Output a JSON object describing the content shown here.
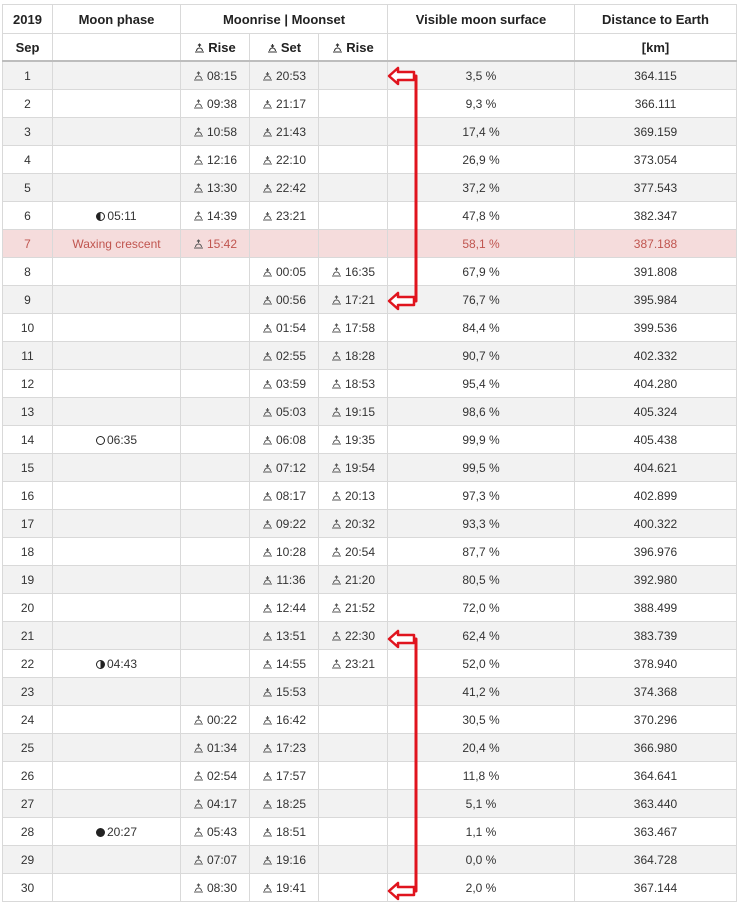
{
  "header": {
    "year": "2019",
    "moon_phase": "Moon phase",
    "moonrise_moonset": "Moonrise | Moonset",
    "visible_surface": "Visible moon surface",
    "distance": "Distance to Earth",
    "month": "Sep",
    "rise1": "Rise",
    "set": "Set",
    "rise2": "Rise",
    "unit": "[km]"
  },
  "rows": [
    {
      "day": "1",
      "phase": "",
      "phase_icon": "",
      "rise1": "08:15",
      "set": "20:53",
      "rise2": "",
      "surface": "3,5 %",
      "distance": "364.115"
    },
    {
      "day": "2",
      "phase": "",
      "phase_icon": "",
      "rise1": "09:38",
      "set": "21:17",
      "rise2": "",
      "surface": "9,3 %",
      "distance": "366.111"
    },
    {
      "day": "3",
      "phase": "",
      "phase_icon": "",
      "rise1": "10:58",
      "set": "21:43",
      "rise2": "",
      "surface": "17,4 %",
      "distance": "369.159"
    },
    {
      "day": "4",
      "phase": "",
      "phase_icon": "",
      "rise1": "12:16",
      "set": "22:10",
      "rise2": "",
      "surface": "26,9 %",
      "distance": "373.054"
    },
    {
      "day": "5",
      "phase": "",
      "phase_icon": "",
      "rise1": "13:30",
      "set": "22:42",
      "rise2": "",
      "surface": "37,2 %",
      "distance": "377.543"
    },
    {
      "day": "6",
      "phase": "05:11",
      "phase_icon": "first-quarter",
      "rise1": "14:39",
      "set": "23:21",
      "rise2": "",
      "surface": "47,8 %",
      "distance": "382.347"
    },
    {
      "day": "7",
      "phase": "Waxing crescent",
      "phase_icon": "",
      "rise1": "15:42",
      "set": "",
      "rise2": "",
      "surface": "58,1 %",
      "distance": "387.188",
      "today": true
    },
    {
      "day": "8",
      "phase": "",
      "phase_icon": "",
      "rise1": "",
      "set": "00:05",
      "rise2": "16:35",
      "surface": "67,9 %",
      "distance": "391.808"
    },
    {
      "day": "9",
      "phase": "",
      "phase_icon": "",
      "rise1": "",
      "set": "00:56",
      "rise2": "17:21",
      "surface": "76,7 %",
      "distance": "395.984"
    },
    {
      "day": "10",
      "phase": "",
      "phase_icon": "",
      "rise1": "",
      "set": "01:54",
      "rise2": "17:58",
      "surface": "84,4 %",
      "distance": "399.536"
    },
    {
      "day": "11",
      "phase": "",
      "phase_icon": "",
      "rise1": "",
      "set": "02:55",
      "rise2": "18:28",
      "surface": "90,7 %",
      "distance": "402.332"
    },
    {
      "day": "12",
      "phase": "",
      "phase_icon": "",
      "rise1": "",
      "set": "03:59",
      "rise2": "18:53",
      "surface": "95,4 %",
      "distance": "404.280"
    },
    {
      "day": "13",
      "phase": "",
      "phase_icon": "",
      "rise1": "",
      "set": "05:03",
      "rise2": "19:15",
      "surface": "98,6 %",
      "distance": "405.324"
    },
    {
      "day": "14",
      "phase": "06:35",
      "phase_icon": "full-moon",
      "rise1": "",
      "set": "06:08",
      "rise2": "19:35",
      "surface": "99,9 %",
      "distance": "405.438"
    },
    {
      "day": "15",
      "phase": "",
      "phase_icon": "",
      "rise1": "",
      "set": "07:12",
      "rise2": "19:54",
      "surface": "99,5 %",
      "distance": "404.621"
    },
    {
      "day": "16",
      "phase": "",
      "phase_icon": "",
      "rise1": "",
      "set": "08:17",
      "rise2": "20:13",
      "surface": "97,3 %",
      "distance": "402.899"
    },
    {
      "day": "17",
      "phase": "",
      "phase_icon": "",
      "rise1": "",
      "set": "09:22",
      "rise2": "20:32",
      "surface": "93,3 %",
      "distance": "400.322"
    },
    {
      "day": "18",
      "phase": "",
      "phase_icon": "",
      "rise1": "",
      "set": "10:28",
      "rise2": "20:54",
      "surface": "87,7 %",
      "distance": "396.976"
    },
    {
      "day": "19",
      "phase": "",
      "phase_icon": "",
      "rise1": "",
      "set": "11:36",
      "rise2": "21:20",
      "surface": "80,5 %",
      "distance": "392.980"
    },
    {
      "day": "20",
      "phase": "",
      "phase_icon": "",
      "rise1": "",
      "set": "12:44",
      "rise2": "21:52",
      "surface": "72,0 %",
      "distance": "388.499"
    },
    {
      "day": "21",
      "phase": "",
      "phase_icon": "",
      "rise1": "",
      "set": "13:51",
      "rise2": "22:30",
      "surface": "62,4 %",
      "distance": "383.739"
    },
    {
      "day": "22",
      "phase": "04:43",
      "phase_icon": "last-quarter",
      "rise1": "",
      "set": "14:55",
      "rise2": "23:21",
      "surface": "52,0 %",
      "distance": "378.940"
    },
    {
      "day": "23",
      "phase": "",
      "phase_icon": "",
      "rise1": "",
      "set": "15:53",
      "rise2": "",
      "surface": "41,2 %",
      "distance": "374.368"
    },
    {
      "day": "24",
      "phase": "",
      "phase_icon": "",
      "rise1": "00:22",
      "set": "16:42",
      "rise2": "",
      "surface": "30,5 %",
      "distance": "370.296"
    },
    {
      "day": "25",
      "phase": "",
      "phase_icon": "",
      "rise1": "01:34",
      "set": "17:23",
      "rise2": "",
      "surface": "20,4 %",
      "distance": "366.980"
    },
    {
      "day": "26",
      "phase": "",
      "phase_icon": "",
      "rise1": "02:54",
      "set": "17:57",
      "rise2": "",
      "surface": "11,8 %",
      "distance": "364.641"
    },
    {
      "day": "27",
      "phase": "",
      "phase_icon": "",
      "rise1": "04:17",
      "set": "18:25",
      "rise2": "",
      "surface": "5,1 %",
      "distance": "363.440"
    },
    {
      "day": "28",
      "phase": "20:27",
      "phase_icon": "new-moon",
      "rise1": "05:43",
      "set": "18:51",
      "rise2": "",
      "surface": "1,1 %",
      "distance": "363.467"
    },
    {
      "day": "29",
      "phase": "",
      "phase_icon": "",
      "rise1": "07:07",
      "set": "19:16",
      "rise2": "",
      "surface": "0,0 %",
      "distance": "364.728"
    },
    {
      "day": "30",
      "phase": "",
      "phase_icon": "",
      "rise1": "08:30",
      "set": "19:41",
      "rise2": "",
      "surface": "2,0 %",
      "distance": "367.144"
    }
  ],
  "icons": {
    "moonrise": "moonrise-icon",
    "moonset": "moonset-icon"
  },
  "colors": {
    "today_row_bg": "#f5dcdc",
    "today_row_text": "#c0554f",
    "annotation_arrow": "#e0141e"
  }
}
